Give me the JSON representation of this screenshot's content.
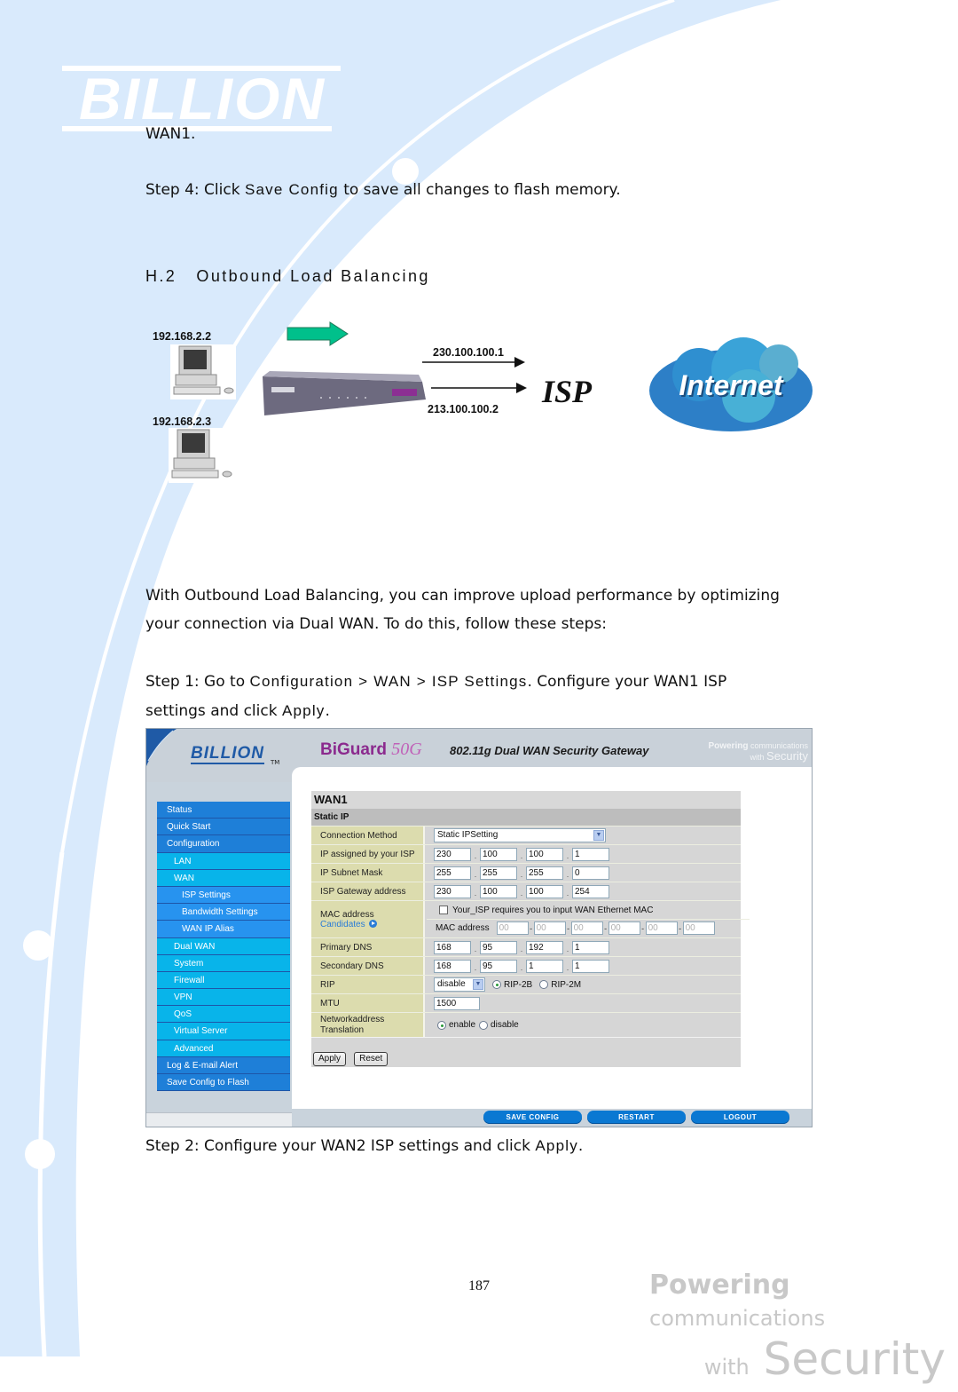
{
  "brand": {
    "logo_text": "BILLION"
  },
  "content": {
    "prev_line": "WAN1.",
    "step4": {
      "prefix": "Step 4: Click ",
      "code": "Save Config",
      "suffix": " to save all changes to flash memory."
    },
    "section_heading": "H.2   Outbound Load Balancing",
    "intro_line1": "With Outbound Load Balancing, you can improve upload performance by optimizing",
    "intro_line2": "your connection via Dual WAN. To do this, follow these steps:",
    "step1": {
      "prefix": "Step 1: Go to ",
      "path": "Configuration > WAN > ISP Settings",
      "suffix": ". Configure your WAN1 ISP",
      "line2_prefix": "settings and click ",
      "line2_code": "Apply",
      "line2_suffix": "."
    },
    "step2": {
      "prefix": "Step 2: Configure your WAN2 ISP settings and click ",
      "code": "Apply",
      "suffix": "."
    }
  },
  "diagram": {
    "pc1_ip": "192.168.2.2",
    "pc2_ip": "192.168.2.3",
    "wan1_ip": "230.100.100.1",
    "wan2_ip": "213.100.100.2",
    "isp_label": "ISP",
    "internet_label": "Internet",
    "arrow_color": "#00c08b"
  },
  "router_ui": {
    "logo": "BILLION",
    "tm": "TM",
    "product": "BiGuard",
    "model": "50G",
    "subtitle": "802.11g Dual WAN Security Gateway",
    "tagline": {
      "powering": "Powering",
      "communications": "communications",
      "with": "with",
      "security": "Security"
    },
    "nav": [
      {
        "label": "Status",
        "level": 1
      },
      {
        "label": "Quick Start",
        "level": 1
      },
      {
        "label": "Configuration",
        "level": 1
      },
      {
        "label": "LAN",
        "level": 2
      },
      {
        "label": "WAN",
        "level": 2
      },
      {
        "label": "ISP Settings",
        "level": 3
      },
      {
        "label": "Bandwidth Settings",
        "level": 3
      },
      {
        "label": "WAN IP Alias",
        "level": 3
      },
      {
        "label": "Dual WAN",
        "level": 2
      },
      {
        "label": "System",
        "level": 2
      },
      {
        "label": "Firewall",
        "level": 2
      },
      {
        "label": "VPN",
        "level": 2
      },
      {
        "label": "QoS",
        "level": 2
      },
      {
        "label": "Virtual Server",
        "level": 2
      },
      {
        "label": "Advanced",
        "level": 2
      },
      {
        "label": "Log & E-mail Alert",
        "level": 1
      },
      {
        "label": "Save Config to Flash",
        "level": 1
      }
    ],
    "panel": {
      "title": "WAN1",
      "subtitle": "Static IP",
      "connection_method": {
        "label": "Connection Method",
        "value": "Static IPSetting"
      },
      "ip_assigned": {
        "label": "IP assigned by your ISP",
        "octets": [
          "230",
          "100",
          "100",
          "1"
        ]
      },
      "subnet_mask": {
        "label": "IP Subnet Mask",
        "octets": [
          "255",
          "255",
          "255",
          "0"
        ]
      },
      "gateway": {
        "label": "ISP Gateway address",
        "octets": [
          "230",
          "100",
          "100",
          "254"
        ]
      },
      "mac": {
        "label": "MAC address",
        "candidates": "Candidates",
        "checkbox_label": "Your_ISP requires you to input WAN Ethernet MAC",
        "checked": false,
        "field_label": "MAC address",
        "octets": [
          "00",
          "00",
          "00",
          "00",
          "00",
          "00"
        ]
      },
      "primary_dns": {
        "label": "Primary DNS",
        "octets": [
          "168",
          "95",
          "192",
          "1"
        ]
      },
      "secondary_dns": {
        "label": "Secondary DNS",
        "octets": [
          "168",
          "95",
          "1",
          "1"
        ]
      },
      "rip": {
        "label": "RIP",
        "value": "disable",
        "options": [
          "RIP-2B",
          "RIP-2M"
        ],
        "selected": "RIP-2B"
      },
      "mtu": {
        "label": "MTU",
        "value": "1500"
      },
      "nat": {
        "label_line1": "Networkaddress",
        "label_line2": "Translation",
        "options": [
          "enable",
          "disable"
        ],
        "selected": "enable"
      },
      "apply": "Apply",
      "reset": "Reset"
    },
    "bottom_buttons": [
      "SAVE CONFIG",
      "RESTART",
      "LOGOUT"
    ]
  },
  "footer": {
    "page_number": "187",
    "tagline": {
      "powering": "Powering",
      "communications": "communications",
      "with": "with",
      "security": "Security"
    }
  }
}
